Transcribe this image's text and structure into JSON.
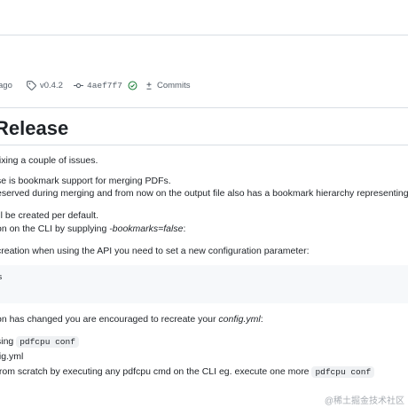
{
  "release_meta": {
    "time_suffix": "ago",
    "tag": "v0.4.2",
    "commit": "4aef7f7",
    "commits_link": "Commits"
  },
  "release": {
    "title": "Release",
    "intro": "fixing a couple of issues.",
    "feature_line": "se is bookmark support for merging PDFs.",
    "feature_detail": "eserved during merging and from now on the output file also has a bookmark hierarchy representing the",
    "default_line": "ill be created per default.",
    "cli_line_prefix": "on on the CLI by supplying ",
    "cli_line_flag": "-bookmarks=false",
    "cli_line_suffix": ":",
    "api_line": "creation when using the API you need to set a new configuration parameter:",
    "code_block": "s",
    "config_line_prefix": "on has changed you are encouraged to recreate your ",
    "config_line_file": "config.yml",
    "config_line_suffix": ":",
    "step1_prefix": "sing ",
    "step1_code": "pdfcpu conf",
    "step2": "fig.yml",
    "step3_prefix": "from scratch by executing any pdfcpu cmd on the CLI eg. execute one more ",
    "step3_code": "pdfcpu conf"
  },
  "watermark": "@稀土掘金技术社区",
  "colors": {
    "text": "#1f2328",
    "muted": "#57606a",
    "verified": "#1a7f37",
    "code_bg": "#f6f8fa",
    "border": "#d8dee4"
  },
  "icons": [
    "tag-icon",
    "commit-icon",
    "check-circle-icon",
    "compare-icon"
  ]
}
